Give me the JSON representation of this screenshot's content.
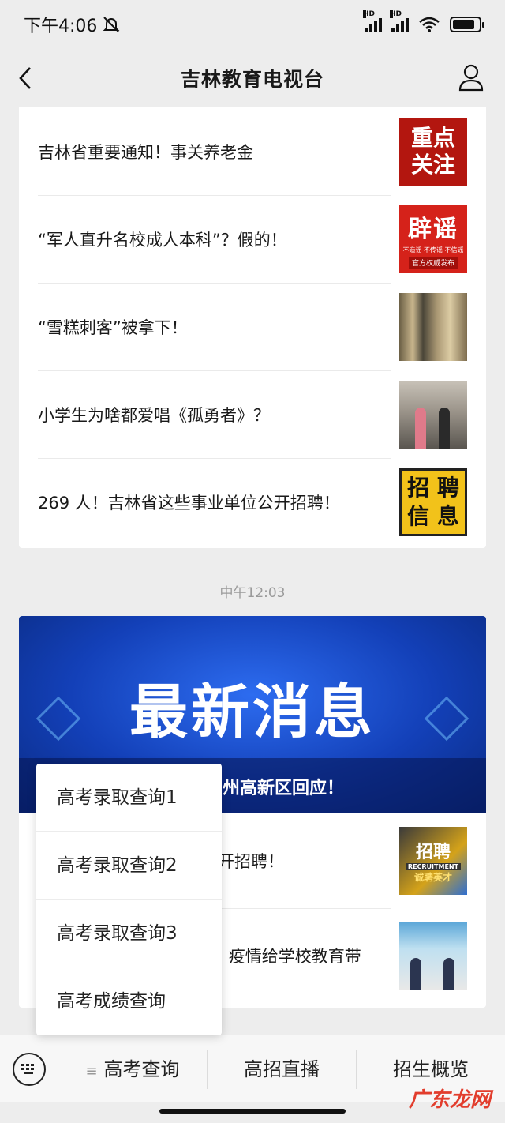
{
  "status_bar": {
    "time": "下午4:06",
    "hd1": "HD",
    "hd2": "HD"
  },
  "nav": {
    "title": "吉林教育电视台"
  },
  "articles_top": [
    {
      "title": "吉林省重要通知！事关养老金",
      "thumb_text": [
        "重点",
        "关注"
      ]
    },
    {
      "title": "“军人直升名校成人本科”？假的！",
      "thumb_text": [
        "辟谣",
        "不造谣 不传谣 不信谣",
        "官方权威发布"
      ]
    },
    {
      "title": "“雪糕刺客”被拿下！"
    },
    {
      "title": "小学生为啥都爱唱《孤勇者》？"
    },
    {
      "title": "269 人！吉林省这些事业单位公开招聘！",
      "thumb_text": [
        "招 聘",
        "信 息"
      ]
    }
  ],
  "timestamp": "中午12:03",
  "banner": {
    "title": "最新消息",
    "caption": "州高新区回应！"
  },
  "articles_bottom": [
    {
      "title": "开招聘！",
      "thumb_text": [
        "招聘",
        "RECRUITMENT",
        "诚聘英才"
      ]
    },
    {
      "title": "| 疫情给学校教育带"
    }
  ],
  "popup_menu": {
    "items": [
      "高考录取查询1",
      "高考录取查询2",
      "高考录取查询3",
      "高考成绩查询"
    ]
  },
  "menu_bar": {
    "items": [
      "高考查询",
      "高招直播",
      "招生概览"
    ],
    "active_icon": "≡"
  },
  "watermark": "广东龙网"
}
